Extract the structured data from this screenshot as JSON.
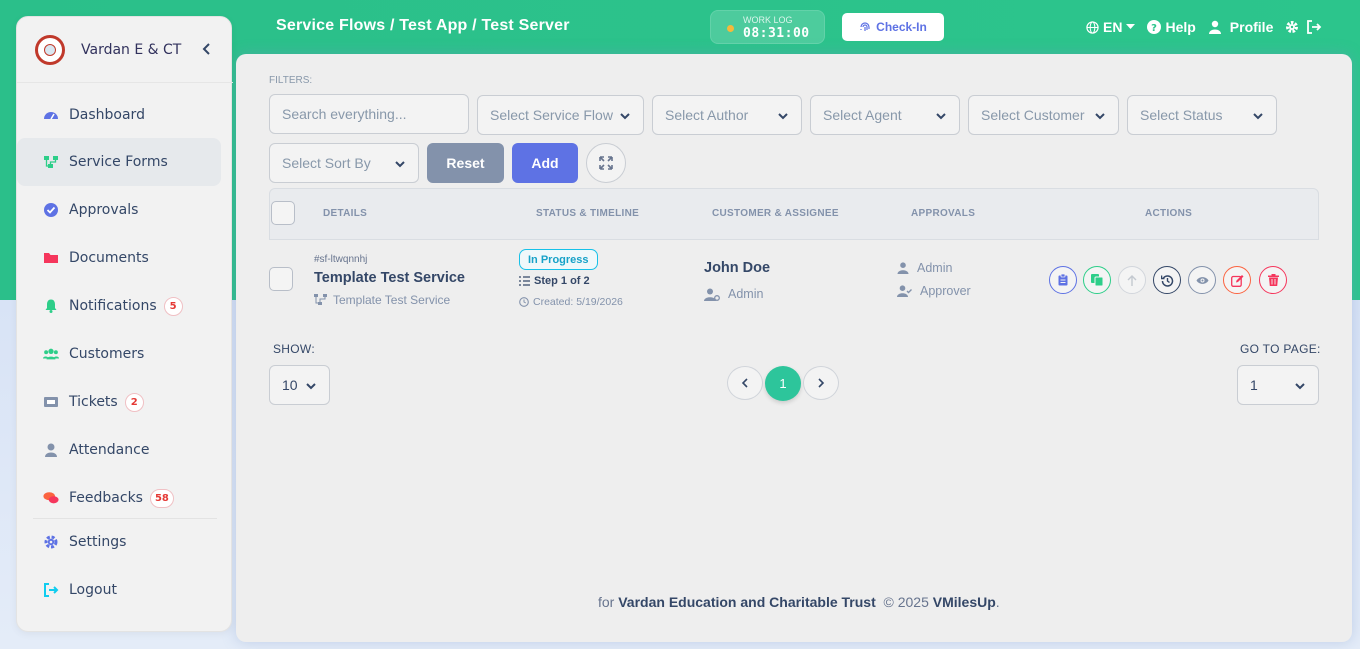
{
  "sidebar": {
    "brand": "Vardan E & CT",
    "items": [
      {
        "label": "Dashboard",
        "icon": "dashboard-icon",
        "color": "#5e72e4"
      },
      {
        "label": "Service Forms",
        "icon": "flow-icon",
        "color": "#2dce89",
        "active": true
      },
      {
        "label": "Approvals",
        "icon": "check-circle-icon",
        "color": "#5e72e4"
      },
      {
        "label": "Documents",
        "icon": "folder-icon",
        "color": "#f5365c"
      },
      {
        "label": "Notifications",
        "icon": "bell-icon",
        "color": "#2dce89",
        "badge": "5"
      },
      {
        "label": "Customers",
        "icon": "users-icon",
        "color": "#2dce89"
      },
      {
        "label": "Tickets",
        "icon": "ticket-icon",
        "color": "#8392ab",
        "badge": "2"
      },
      {
        "label": "Attendance",
        "icon": "user-icon",
        "color": "#8392ab"
      },
      {
        "label": "Feedbacks",
        "icon": "comments-icon",
        "color": "#fb6340",
        "badge": "58"
      },
      {
        "label": "Settings",
        "icon": "gear-icon",
        "color": "#5e72e4"
      },
      {
        "label": "Logout",
        "icon": "logout-icon",
        "color": "#11cdef"
      }
    ]
  },
  "header": {
    "breadcrumb": "Service Flows / Test App / Test Server",
    "worklog_label": "WORK LOG",
    "worklog_time": "08:31:00",
    "checkin_label": "Check-In",
    "language": "EN",
    "help_label": "Help",
    "profile_label": "Profile"
  },
  "filters": {
    "label": "FILTERS:",
    "search_placeholder": "Search everything...",
    "service_flow": "Select Service Flow",
    "author": "Select Author",
    "agent": "Select Agent",
    "customer": "Select Customer",
    "status": "Select Status",
    "sort_by": "Select Sort By",
    "reset_label": "Reset",
    "add_label": "Add"
  },
  "table": {
    "headers": [
      "DETAILS",
      "STATUS & TIMELINE",
      "CUSTOMER & ASSIGNEE",
      "APPROVALS",
      "ACTIONS"
    ],
    "rows": [
      {
        "id": "#sf-ltwqnnhj",
        "title": "Template Test Service",
        "flow": "Template Test Service",
        "status": "In Progress",
        "step": "Step 1 of 2",
        "created": "Created: 5/19/2026",
        "customer": "John Doe",
        "assignee": "Admin",
        "approvals": [
          "Admin",
          "Approver"
        ]
      }
    ]
  },
  "pagination": {
    "show_label": "SHOW:",
    "page_size": "10",
    "current_page": "1",
    "goto_label": "GO TO PAGE:",
    "goto_value": "1"
  },
  "footer": {
    "prefix": "for",
    "org": "Vardan Education and Charitable Trust",
    "copyright": "© 2025",
    "brand": "VMilesUp",
    "suffix": "."
  },
  "colors": {
    "accent": "#5e72e4",
    "brand_green": "#2cc58c",
    "danger": "#f5365c"
  }
}
